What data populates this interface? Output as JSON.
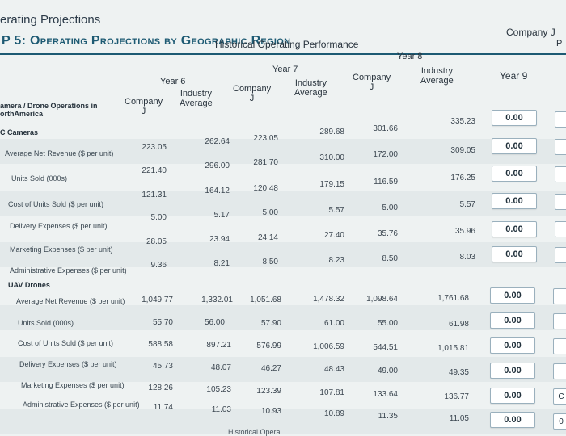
{
  "page_title": "erating Projections",
  "chart_title": "P 5: Operating Projections by Geographic Region",
  "headers": {
    "historical": "Historical Operating Performance",
    "company_j_cut": "Company J",
    "p_cut": "P",
    "year6": "Year 6",
    "year7": "Year 7",
    "year8": "Year 8",
    "year9": "Year 9",
    "company": "Company",
    "j": "J",
    "industry": "Industry",
    "average": "Average"
  },
  "section_label": "amera / Drone Operations in\northAmerica",
  "groups": {
    "cameras": "C Cameras",
    "drones": "UAV Drones"
  },
  "rows": [
    {
      "label": "Average Net Revenue ($ per unit)",
      "values": [
        "223.05",
        "262.64",
        "223.05",
        "289.68",
        "301.66",
        "335.23"
      ],
      "input": "0.00"
    },
    {
      "label": "Units Sold (000s)",
      "values": [
        "221.40",
        "296.00",
        "281.70",
        "310.00",
        "172.00",
        "309.05"
      ],
      "input": "0.00"
    },
    {
      "label": "Cost of Units Sold ($ per unit)",
      "values": [
        "121.31",
        "164.12",
        "120.48",
        "179.15",
        "116.59",
        "176.25"
      ],
      "input": "0.00"
    },
    {
      "label": "Delivery Expenses ($ per unit)",
      "values": [
        "5.00",
        "5.17",
        "5.00",
        "5.57",
        "5.00",
        "5.57"
      ],
      "input": "0.00"
    },
    {
      "label": "Marketing Expenses ($ per unit)",
      "values": [
        "28.05",
        "23.94",
        "24.14",
        "27.40",
        "35.76",
        "35.96"
      ],
      "input": "0.00"
    },
    {
      "label": "Administrative Expenses ($ per unit)",
      "values": [
        "9.36",
        "8.21",
        "8.50",
        "8.23",
        "8.50",
        "8.03"
      ],
      "input": "0.00"
    },
    {
      "label": "Average Net Revenue ($ per unit)",
      "values": [
        "1,049.77",
        "1,332.01",
        "1,051.68",
        "1,478.32",
        "1,098.64",
        "1,761.68"
      ],
      "input": "0.00"
    },
    {
      "label": "Units Sold (000s)",
      "values": [
        "55.70",
        "56.00",
        "57.90",
        "61.00",
        "55.00",
        "61.98"
      ],
      "input": "0.00"
    },
    {
      "label": "Cost of Units Sold ($ per unit)",
      "values": [
        "588.58",
        "897.21",
        "576.99",
        "1,006.59",
        "544.51",
        "1,015.81"
      ],
      "input": "0.00"
    },
    {
      "label": "Delivery Expenses ($ per unit)",
      "values": [
        "45.73",
        "48.07",
        "46.27",
        "48.43",
        "49.00",
        "49.35"
      ],
      "input": "0.00"
    },
    {
      "label": "Marketing Expenses ($ per unit)",
      "values": [
        "128.26",
        "105.23",
        "123.39",
        "107.81",
        "133.64",
        "136.77"
      ],
      "input": "0.00"
    },
    {
      "label": "Administrative Expenses ($ per unit)",
      "values": [
        "11.74",
        "11.03",
        "10.93",
        "10.89",
        "11.35",
        "11.05"
      ],
      "input": "0.00"
    }
  ],
  "edge_values": [
    "C",
    "C",
    "0"
  ],
  "footer_cut": "Historical Opera"
}
